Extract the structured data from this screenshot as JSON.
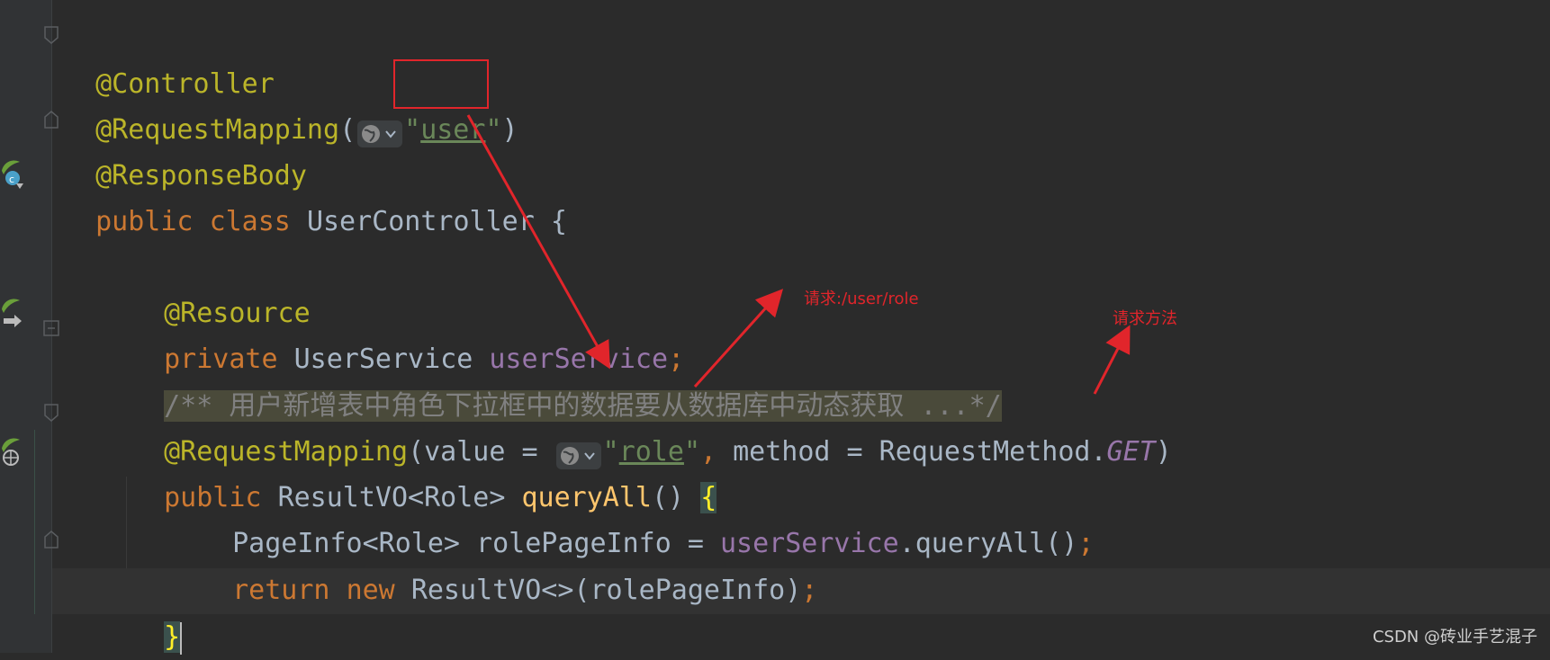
{
  "editor": {
    "lines": {
      "l0": {
        "ann": "@Controller"
      },
      "l1": {
        "ann": "@RequestMapping",
        "open": "(",
        "q1": "\"",
        "val": "user",
        "q2": "\"",
        "close": ")"
      },
      "l2": {
        "ann": "@ResponseBody"
      },
      "l3": {
        "kw1": "public",
        "kw2": "class",
        "name": "UserController {"
      },
      "l5": {
        "ann": "@Resource"
      },
      "l6": {
        "kw": "private",
        "type": "UserService",
        "field": "userService",
        "semi": ";"
      },
      "l7": {
        "comment": "/** 用户新增表中角色下拉框中的数据要从数据库中动态获取 ...*/"
      },
      "l8": {
        "ann": "@RequestMapping",
        "p1": "(value = ",
        "q1": "\"",
        "val": "role",
        "q2": "\"",
        "comma": ",",
        "p2": " method = RequestMethod.",
        "const": "GET",
        "close": ")"
      },
      "l9": {
        "kw": "public",
        "sig1": "ResultVO<Role> ",
        "method": "queryAll",
        "sig2": "() ",
        "brace": "{"
      },
      "l10": {
        "pre": "PageInfo<Role> rolePageInfo = ",
        "field": "userService",
        "post": ".queryAll()",
        "semi": ";"
      },
      "l11": {
        "kw1": "return",
        "kw2": "new",
        "rest": "ResultVO<>(rolePageInfo)",
        "semi": ";"
      },
      "l12": {
        "brace": "}"
      }
    }
  },
  "annotations": {
    "note_url": "请求:/user/role",
    "note_method": "请求方法"
  },
  "watermark": "CSDN @砖业手艺混子",
  "colors": {
    "annotation": "#bbb529",
    "keyword": "#cc7832",
    "string": "#6a8759",
    "field": "#9876aa",
    "method": "#ffc66d",
    "red_markup": "#e1252b"
  }
}
